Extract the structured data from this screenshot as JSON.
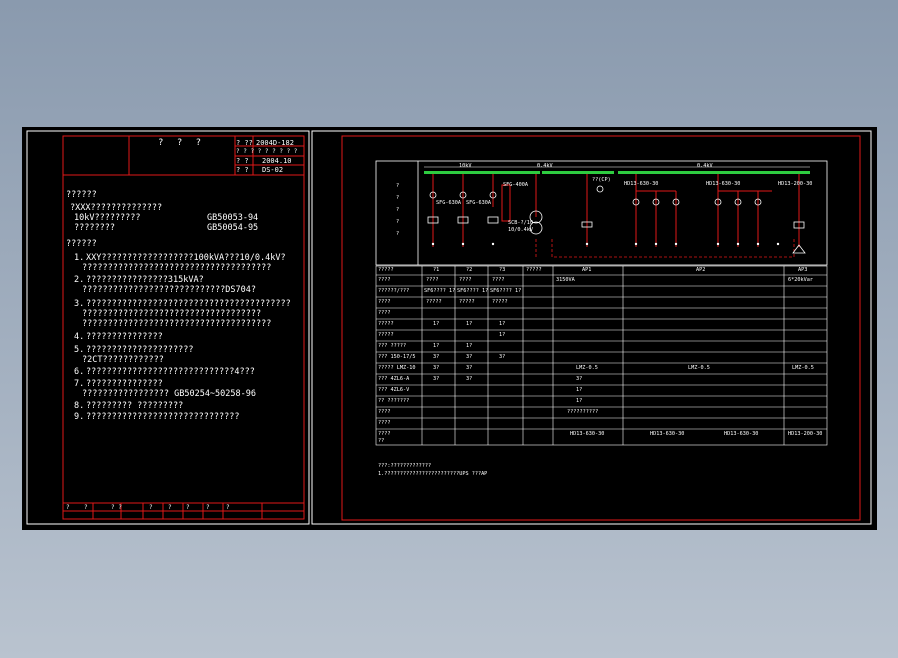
{
  "left_sheet": {
    "title_block": {
      "main_title": "? ? ?",
      "rows": [
        [
          "? ??",
          "2004D-182"
        ],
        [
          "? ? ? ? ? ? ? ? ?",
          ""
        ],
        [
          "? ?",
          "2004.10"
        ],
        [
          "? ?",
          "DS-02"
        ]
      ]
    },
    "notes": {
      "section1_heading": "??????",
      "section1_lines": [
        "?XXX??????????????",
        "10kV?????????",
        "????????"
      ],
      "standards": [
        "GB50053-94",
        "GB50054-95"
      ],
      "section2_heading": "??????",
      "items": [
        {
          "num": "1.",
          "lines": [
            "XXY??????????????????100kVA???10/0.4kV?",
            "?????????????????????????????????????"
          ]
        },
        {
          "num": "2.",
          "lines": [
            "????????????????315kVA?",
            "????????????????????????????DS704?"
          ]
        },
        {
          "num": "3.",
          "lines": [
            "????????????????????????????????????????",
            "???????????????????????????????????",
            "?????????????????????????????????????"
          ]
        },
        {
          "num": "4.",
          "lines": [
            "???????????????"
          ]
        },
        {
          "num": "5.",
          "lines": [
            "?????????????????????",
            "?2CT????????????"
          ]
        },
        {
          "num": "6.",
          "lines": [
            "?????????????????????????????4???"
          ]
        },
        {
          "num": "7.",
          "lines": [
            "???????????????",
            "?????????????????  GB50254~50258-96"
          ]
        },
        {
          "num": "8.",
          "lines": [
            "????????? ?????????"
          ]
        },
        {
          "num": "9.",
          "lines": [
            "??????????????????????????????"
          ]
        }
      ]
    },
    "bottom_strip": [
      "?",
      "?",
      "? ?",
      "?",
      "?",
      "?",
      "?",
      "?"
    ]
  },
  "right_sheet": {
    "bus_labels": [
      "10kV",
      "0.4kV",
      "0.4kV"
    ],
    "side_labels": [
      "?",
      "?",
      "?",
      "?",
      "?"
    ],
    "cabinet_labels": {
      "hv": [
        "SFG-630A",
        "SFG-630A",
        "SFG-400A"
      ],
      "transformer": [
        "SCB-?/10",
        "10/0.4kV"
      ],
      "lv": [
        "HD13-630-30",
        "HD13-630-30",
        "HD13-200-30"
      ],
      "meter": "??(CP)"
    },
    "table": {
      "header": [
        "?????",
        "?1",
        "?2",
        "?3",
        "?????",
        "AP1",
        "AP2",
        "AP3"
      ],
      "rows": [
        [
          "????",
          "????",
          "????",
          "????",
          "",
          "3150VA",
          "",
          "6*20kVar"
        ],
        [
          "??????/???",
          "SF6???? 1?",
          "SF6???? 1?",
          "SF6???? 1?",
          "",
          "",
          "",
          ""
        ],
        [
          "????",
          "?????",
          "?????",
          "?????",
          "",
          "",
          "",
          ""
        ],
        [
          "????",
          "",
          "",
          "",
          "",
          "",
          "",
          ""
        ],
        [
          "?????",
          "1?",
          "1?",
          "1?",
          "",
          "",
          "",
          ""
        ],
        [
          "?????",
          "",
          "",
          "1?",
          "",
          "",
          "",
          ""
        ],
        [
          "???  ?????",
          "1?",
          "1?",
          "",
          "",
          "",
          "",
          ""
        ],
        [
          "???  150-17/5",
          "3?",
          "3?",
          "3?",
          "",
          "",
          "",
          ""
        ],
        [
          "?????  LMZ-10",
          "3?",
          "3?",
          "",
          "",
          "LMZ-0.5",
          "LMZ-0.5",
          "LMZ-0.5"
        ],
        [
          "???  4ZL6-A",
          "3?",
          "3?",
          "",
          "3?",
          "",
          "",
          ""
        ],
        [
          "???  4ZL6-V",
          "",
          "",
          "",
          "1?",
          "",
          "",
          ""
        ],
        [
          "?? ???????",
          "",
          "",
          "",
          "1?",
          "",
          "",
          ""
        ],
        [
          "????",
          "",
          "",
          "",
          "??????????",
          "",
          "",
          ""
        ],
        [
          "????",
          "",
          "",
          "",
          "",
          "",
          "",
          ""
        ],
        [
          "????",
          "",
          "",
          "",
          "HD13-630-30",
          "HD13-630-30",
          "HD13-630-30",
          "HD13-200-30"
        ],
        [
          "??",
          "",
          "",
          "",
          "",
          "",
          "",
          ""
        ]
      ]
    },
    "footnotes": [
      "???:?????????????",
      "  1.????????????????????????UPS ???AP"
    ]
  }
}
